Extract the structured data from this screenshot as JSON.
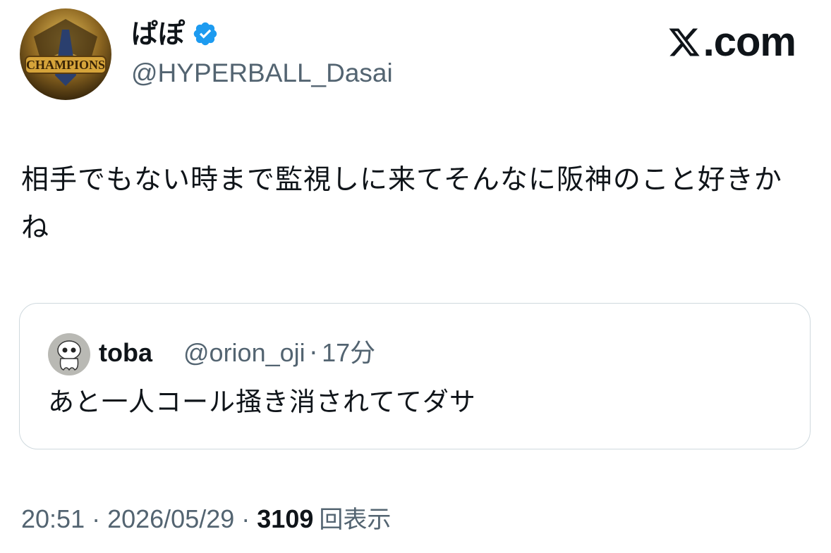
{
  "author": {
    "display_name": "ぱぽ",
    "handle": "@HYPERBALL_Dasai",
    "avatar_icon": "champions-badge-avatar",
    "verified_icon": "verified-badge-icon"
  },
  "brand": {
    "logo_icon": "x-logo-icon",
    "text": ".com"
  },
  "tweet": {
    "text": "相手でもない時まで監視しに来てそんなに阪神のこと好きかね"
  },
  "quoted_tweet": {
    "display_name": "toba",
    "handle": "@orion_oji",
    "separator": "·",
    "time": "17分",
    "text": "あと一人コール掻き消されててダサ",
    "avatar_icon": "ghost-character-avatar"
  },
  "meta": {
    "time": "20:51",
    "separator": "·",
    "date": "2026/05/29",
    "views_count": "3109",
    "views_label": "回表示"
  },
  "colors": {
    "text_primary": "#0f1419",
    "text_secondary": "#536471",
    "verified_blue": "#1d9bf0",
    "border": "#cfd9de"
  }
}
